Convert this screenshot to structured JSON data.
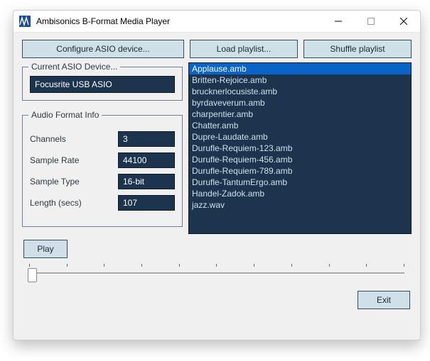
{
  "window": {
    "title": "Ambisonics B-Format Media Player"
  },
  "buttons": {
    "configure": "Configure ASIO device...",
    "load": "Load playlist...",
    "shuffle": "Shuffle playlist",
    "play": "Play",
    "exit": "Exit"
  },
  "device_group": {
    "legend": "Current ASIO Device...",
    "value": "Focusrite USB ASIO"
  },
  "format_group": {
    "legend": "Audio Format Info",
    "rows": {
      "channels": {
        "label": "Channels",
        "value": "3"
      },
      "sample_rate": {
        "label": "Sample Rate",
        "value": "44100"
      },
      "sample_type": {
        "label": "Sample Type",
        "value": "16-bit"
      },
      "length": {
        "label": "Length (secs)",
        "value": "107"
      }
    }
  },
  "playlist": {
    "selected_index": 0,
    "items": [
      "Applause.amb",
      "Britten-Rejoice.amb",
      "brucknerlocusiste.amb",
      "byrdaveverum.amb",
      "charpentier.amb",
      "Chatter.amb",
      "Dupre-Laudate.amb",
      "Durufle-Requiem-123.amb",
      "Durufle-Requiem-456.amb",
      "Durufle-Requiem-789.amb",
      "Durufle-TantumErgo.amb",
      "Handel-Zadok.amb",
      "jazz.wav"
    ]
  },
  "slider": {
    "position_pct": 0
  }
}
